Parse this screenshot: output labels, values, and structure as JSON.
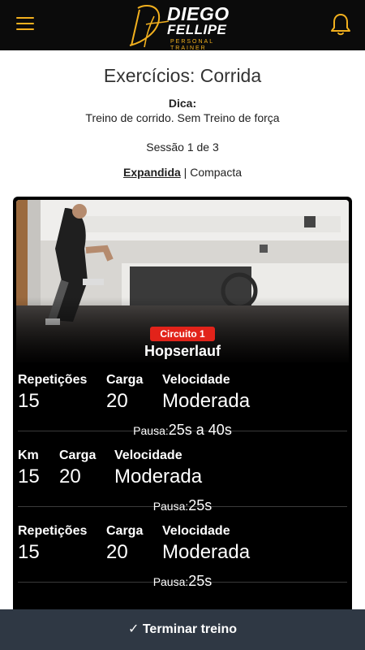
{
  "header": {
    "logo": {
      "line1": "DIEGO",
      "line2": "FELLIPE",
      "line3": "PERSONAL TRAINER",
      "monogram": "DF"
    },
    "menu_icon": "hamburger-menu-icon",
    "bell_icon": "bell-icon",
    "accent_color": "#f2b01e"
  },
  "page": {
    "title": "Exercícios: Corrida",
    "dica_label": "Dica:",
    "dica_text": "Treino de corrido. Sem Treino de força",
    "sessao": "Sessão 1 de 3",
    "view_expandida": "Expandida",
    "view_separator": "|",
    "view_compacta": "Compacta"
  },
  "exercise": {
    "circuito": "Circuito 1",
    "name": "Hopserlauf",
    "badge_color": "#e2231a",
    "sets": [
      {
        "labels": [
          "Repetições",
          "Carga",
          "Velocidade"
        ],
        "values": [
          "15",
          "20",
          "Moderada"
        ],
        "pausa_label": "Pausa:",
        "pausa_value": "25s a 40s"
      },
      {
        "labels": [
          "Km",
          "Carga",
          "Velocidade"
        ],
        "values": [
          "15",
          "20",
          "Moderada"
        ],
        "pausa_label": "Pausa:",
        "pausa_value": "25s"
      },
      {
        "labels": [
          "Repetições",
          "Carga",
          "Velocidade"
        ],
        "values": [
          "15",
          "20",
          "Moderada"
        ],
        "pausa_label": "Pausa:",
        "pausa_value": "25s"
      }
    ]
  },
  "footer": {
    "check_icon": "check-icon",
    "check_glyph": "✓",
    "finish_label": "Terminar treino"
  }
}
